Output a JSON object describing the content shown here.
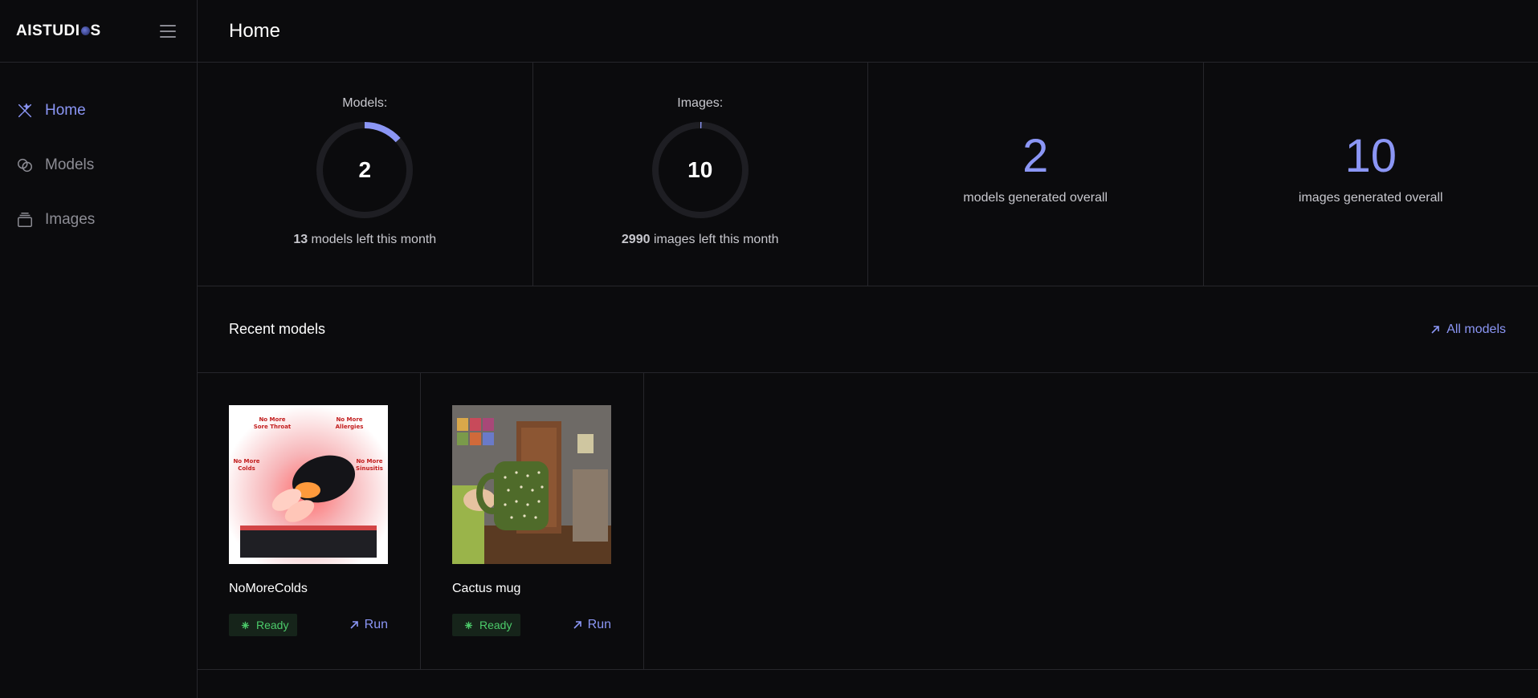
{
  "brand": {
    "logo_text": "AISTUDI",
    "logo_suffix": "S"
  },
  "sidebar": {
    "items": [
      {
        "label": "Home",
        "icon": "home-sparkle-icon",
        "active": true
      },
      {
        "label": "Models",
        "icon": "models-icon",
        "active": false
      },
      {
        "label": "Images",
        "icon": "images-stack-icon",
        "active": false
      }
    ]
  },
  "header": {
    "title": "Home"
  },
  "stats": {
    "models": {
      "label": "Models:",
      "value": "2",
      "used": 2,
      "total": 15,
      "left_count": "13",
      "left_text": " models left this month"
    },
    "images": {
      "label": "Images:",
      "value": "10",
      "used": 10,
      "total": 3000,
      "left_count": "2990",
      "left_text": " images left this month"
    },
    "models_overall": {
      "value": "2",
      "caption": "models generated overall"
    },
    "images_overall": {
      "value": "10",
      "caption": "images generated overall"
    }
  },
  "recent": {
    "title": "Recent models",
    "all_link": "All models",
    "cards": [
      {
        "name": "NoMoreColds",
        "status": "Ready",
        "action": "Run",
        "thumb_labels": [
          "No More",
          "Sore Throat",
          "No More",
          "Allergies",
          "No More",
          "Colds",
          "No More",
          "Sinusitis"
        ]
      },
      {
        "name": "Cactus mug",
        "status": "Ready",
        "action": "Run"
      }
    ]
  },
  "colors": {
    "accent": "#8b96f5",
    "ready": "#4ccb6a",
    "ready_bg": "#16241a",
    "background": "#0b0b0d",
    "border": "#26262b"
  }
}
